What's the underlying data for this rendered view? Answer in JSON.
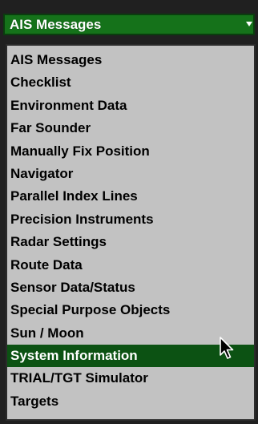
{
  "combo": {
    "selected_label": "AIS Messages",
    "accent_color": "#15721a"
  },
  "list": {
    "items": [
      {
        "label": "AIS Messages"
      },
      {
        "label": "Checklist"
      },
      {
        "label": "Environment Data"
      },
      {
        "label": "Far Sounder"
      },
      {
        "label": "Manually Fix Position"
      },
      {
        "label": "Navigator"
      },
      {
        "label": "Parallel Index Lines"
      },
      {
        "label": "Precision Instruments"
      },
      {
        "label": "Radar Settings"
      },
      {
        "label": "Route Data"
      },
      {
        "label": "Sensor Data/Status"
      },
      {
        "label": "Special Purpose Objects"
      },
      {
        "label": "Sun / Moon"
      },
      {
        "label": "System Information",
        "highlighted": true
      },
      {
        "label": "TRIAL/TGT Simulator"
      },
      {
        "label": "Targets"
      }
    ],
    "highlight_color": "#0c5213"
  },
  "cursor_icon": "arrow-cursor-icon"
}
